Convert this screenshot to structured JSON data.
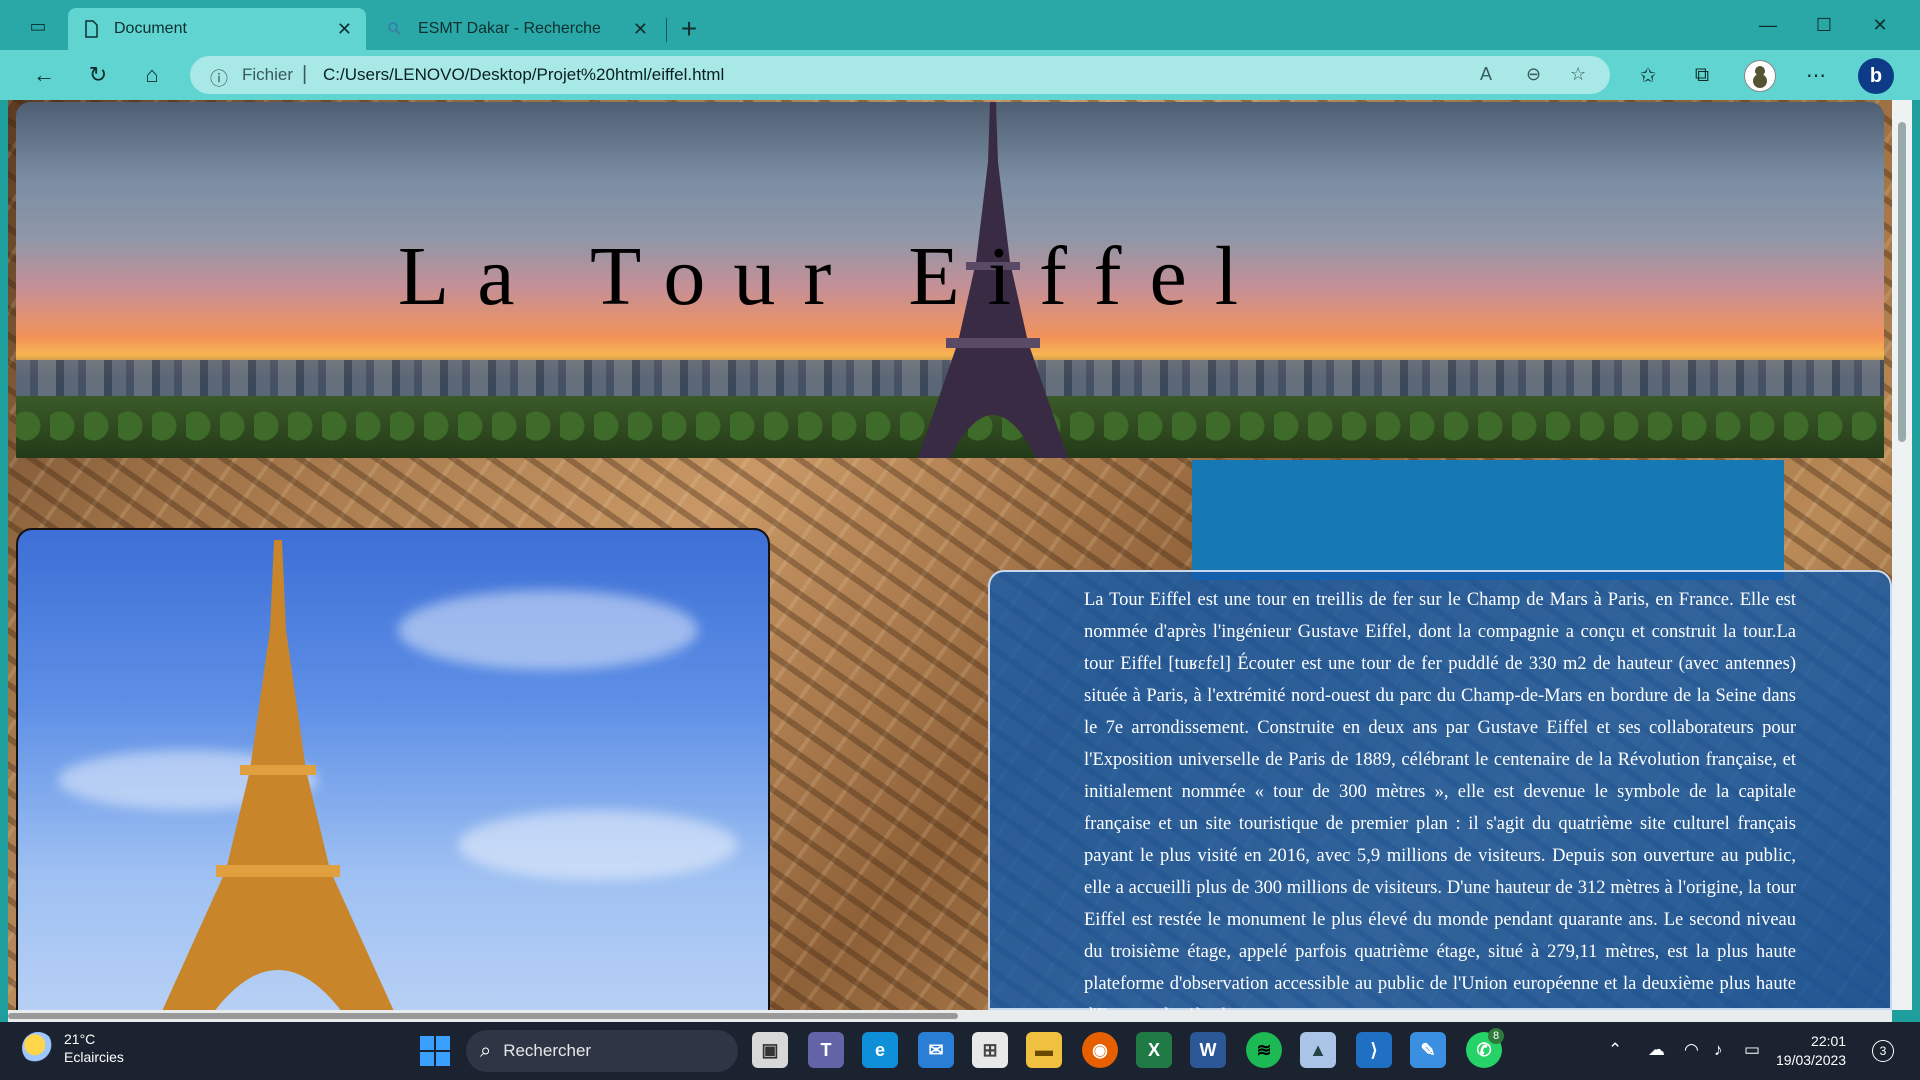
{
  "browser": {
    "tabs": [
      {
        "label": "Document",
        "active": true
      },
      {
        "label": "ESMT Dakar - Recherche",
        "active": false
      }
    ],
    "address": {
      "scheme_label": "Fichier",
      "url": "C:/Users/LENOVO/Desktop/Projet%20html/eiffel.html"
    }
  },
  "page": {
    "title": "La Tour Eiffel",
    "article": "La Tour Eiffel est une tour en treillis de fer sur le Champ de Mars à Paris, en France. Elle est nommée d'après l'ingénieur Gustave Eiffel, dont la compagnie a conçu et construit la tour.La tour Eiffel [tuʁɛfɛl] Écouter est une tour de fer puddlé de 330 m2 de hauteur (avec antennes) située à Paris, à l'extrémité nord-ouest du parc du Champ-de-Mars en bordure de la Seine dans le 7e arrondissement. Construite en deux ans par Gustave Eiffel et ses collaborateurs pour l'Exposition universelle de Paris de 1889, célébrant le centenaire de la Révolution française, et initialement nommée « tour de 300 mètres », elle est devenue le symbole de la capitale française et un site touristique de premier plan : il s'agit du quatrième site culturel français payant le plus visité en 2016, avec 5,9 millions de visiteurs. Depuis son ouverture au public, elle a accueilli plus de 300 millions de visiteurs. D'une hauteur de 312 mètres à l'origine, la tour Eiffel est restée le monument le plus élevé du monde pendant quarante ans. Le second niveau du troisième étage, appelé parfois quatrième étage, situé à 279,11 mètres, est la plus haute plateforme d'observation accessible au public de l'Union européenne et la deuxième plus haute d'Europe, derrière la"
  },
  "taskbar": {
    "weather_temp": "21°C",
    "weather_desc": "Eclaircies",
    "search_label": "Rechercher",
    "time": "22:01",
    "date": "19/03/2023",
    "notification_count": "3",
    "whatsapp_badge": "8"
  },
  "colors": {
    "chrome": "#2aa8a8",
    "toolbar": "#5fd4d0",
    "panel": "#1679b4"
  }
}
